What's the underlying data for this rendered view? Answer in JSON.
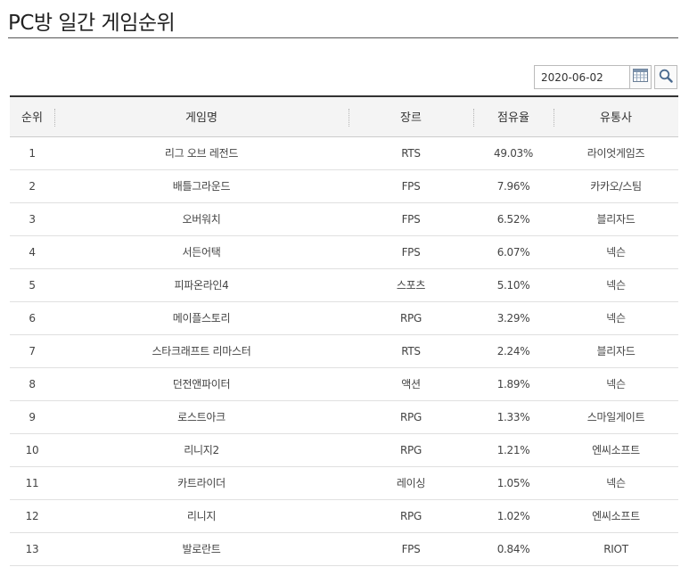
{
  "page": {
    "title": "PC방 일간 게임순위"
  },
  "filter": {
    "date_value": "2020-06-02",
    "calendar_icon": "calendar-icon",
    "search_icon": "search-icon"
  },
  "table": {
    "headers": [
      "순위",
      "게임명",
      "장르",
      "점유율",
      "유통사"
    ],
    "rows": [
      {
        "rank": "1",
        "name": "리그 오브 레전드",
        "genre": "RTS",
        "share": "49.03%",
        "publisher": "라이엇게임즈"
      },
      {
        "rank": "2",
        "name": "배틀그라운드",
        "genre": "FPS",
        "share": "7.96%",
        "publisher": "카카오/스팀"
      },
      {
        "rank": "3",
        "name": "오버워치",
        "genre": "FPS",
        "share": "6.52%",
        "publisher": "블리자드"
      },
      {
        "rank": "4",
        "name": "서든어택",
        "genre": "FPS",
        "share": "6.07%",
        "publisher": "넥슨"
      },
      {
        "rank": "5",
        "name": "피파온라인4",
        "genre": "스포츠",
        "share": "5.10%",
        "publisher": "넥슨"
      },
      {
        "rank": "6",
        "name": "메이플스토리",
        "genre": "RPG",
        "share": "3.29%",
        "publisher": "넥슨"
      },
      {
        "rank": "7",
        "name": "스타크래프트 리마스터",
        "genre": "RTS",
        "share": "2.24%",
        "publisher": "블리자드"
      },
      {
        "rank": "8",
        "name": "던전앤파이터",
        "genre": "액션",
        "share": "1.89%",
        "publisher": "넥슨"
      },
      {
        "rank": "9",
        "name": "로스트아크",
        "genre": "RPG",
        "share": "1.33%",
        "publisher": "스마일게이트"
      },
      {
        "rank": "10",
        "name": "리니지2",
        "genre": "RPG",
        "share": "1.21%",
        "publisher": "엔씨소프트"
      },
      {
        "rank": "11",
        "name": "카트라이더",
        "genre": "레이싱",
        "share": "1.05%",
        "publisher": "넥슨"
      },
      {
        "rank": "12",
        "name": "리니지",
        "genre": "RPG",
        "share": "1.02%",
        "publisher": "엔씨소프트"
      },
      {
        "rank": "13",
        "name": "발로란트",
        "genre": "FPS",
        "share": "0.84%",
        "publisher": "RIOT"
      }
    ]
  }
}
